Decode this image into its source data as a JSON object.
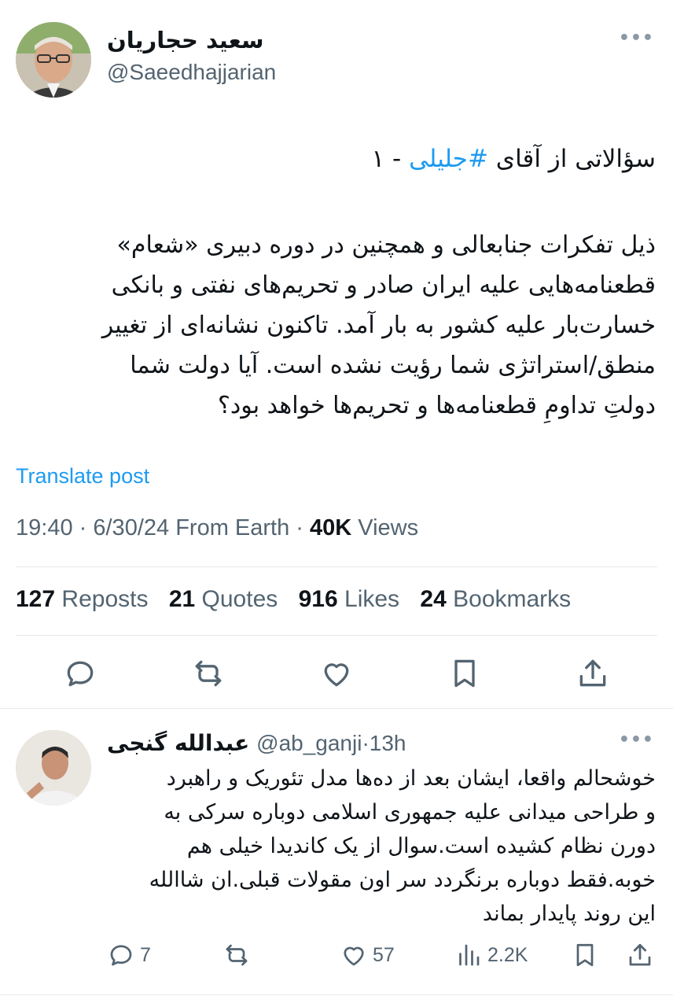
{
  "author": {
    "name": "سعید حجاریان",
    "handle": "@Saeedhajjarian"
  },
  "tweet": {
    "title_prefix": "سؤالاتی از آقای ",
    "hashtag": "#جلیلی",
    "title_suffix": " - ۱",
    "body_lines": [
      "ذیل تفکرات جنابعالی و همچنین در دوره دبیری «شعام»",
      "قطعنامه‌هایی علیه ایران صادر و تحریم‌های نفتی و بانکی",
      "خسارت‌بار علیه کشور به بار آمد. تاکنون نشانه‌ای از تغییر",
      "منطق/استراتژی شما رؤیت نشده است. آیا دولت شما",
      "دولتِ تداومِ قطعنامه‌ها و تحریم‌ها خواهد بود؟"
    ],
    "translate_label": "Translate post",
    "time": "19:40",
    "date": "6/30/24",
    "source": "From Earth",
    "views_count": "40K",
    "views_label": "Views"
  },
  "stats": {
    "reposts_count": "127",
    "reposts_label": "Reposts",
    "quotes_count": "21",
    "quotes_label": "Quotes",
    "likes_count": "916",
    "likes_label": "Likes",
    "bookmarks_count": "24",
    "bookmarks_label": "Bookmarks"
  },
  "reply": {
    "name": "عبدالله گنجی",
    "handle": "@ab_ganji",
    "time": "13h",
    "body_lines": [
      "خوشحالم واقعا، ایشان بعد از ده‌ها مدل تئوریک و راهبرد",
      "و طراحی میدانی علیه جمهوری اسلامی دوباره سرکی به",
      "دورن نظام کشیده است.سوال از یک کاندیدا خیلی هم",
      "خوبه.فقط دوباره برنگردد سر اون مقولات قبلی.ان شاالله",
      "این روند پایدار بماند"
    ],
    "replies": "7",
    "likes": "57",
    "views": "2.2K"
  },
  "colors": {
    "accent": "#1d9bf0",
    "muted": "#536471",
    "text": "#0f1419",
    "divider": "#e6e9ec"
  },
  "icons": [
    "more-icon",
    "reply-icon",
    "repost-icon",
    "like-icon",
    "bookmark-icon",
    "share-icon",
    "views-icon"
  ]
}
